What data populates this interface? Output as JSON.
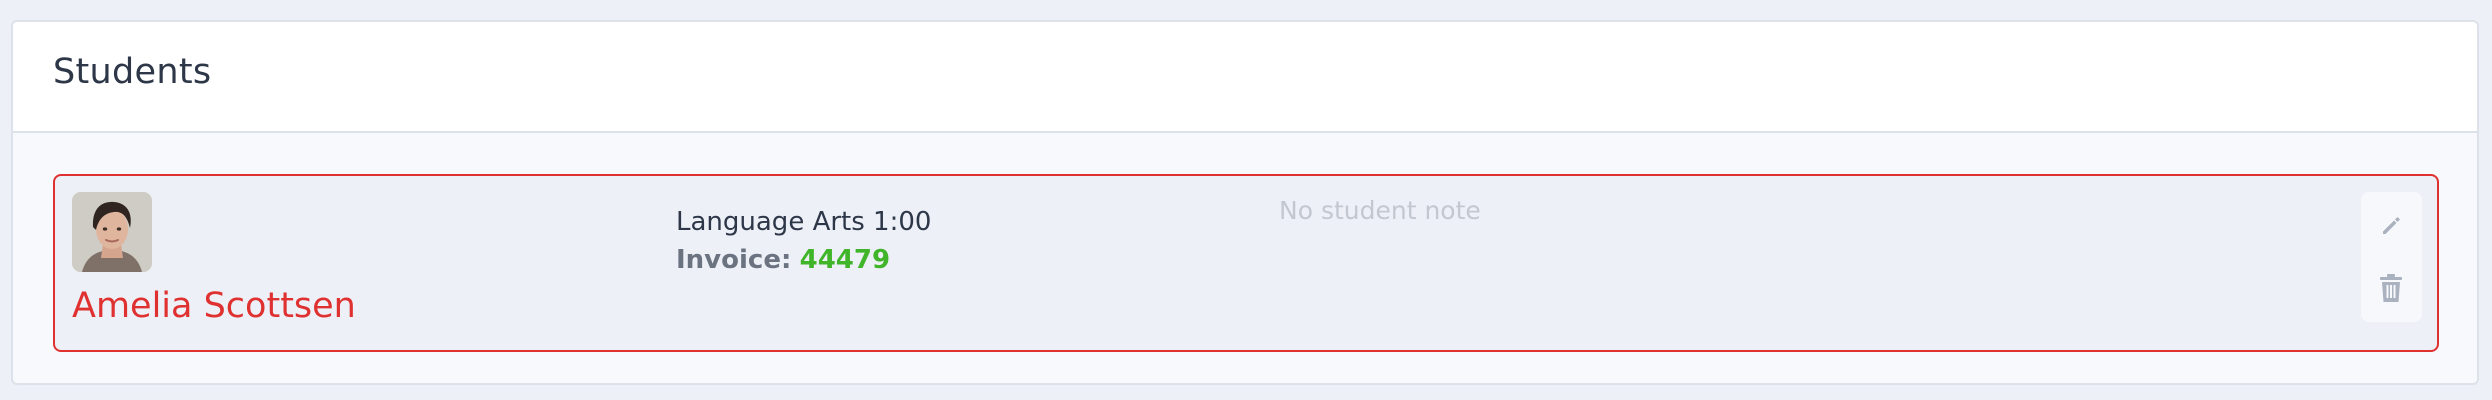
{
  "panel": {
    "title": "Students"
  },
  "students": [
    {
      "name": "Amelia Scottsen",
      "lesson": "Language Arts 1:00",
      "invoice_label": "Invoice:",
      "invoice_number": "44479",
      "note": "No student note",
      "avatar_icon": "student-photo",
      "actions": {
        "edit_icon": "pencil-icon",
        "delete_icon": "trash-icon"
      }
    }
  ],
  "colors": {
    "page_background": "#edf1f7",
    "card_border": "#e03131",
    "student_name": "#e03131",
    "invoice_number": "#40b529",
    "muted_text": "#c2c7d0"
  }
}
